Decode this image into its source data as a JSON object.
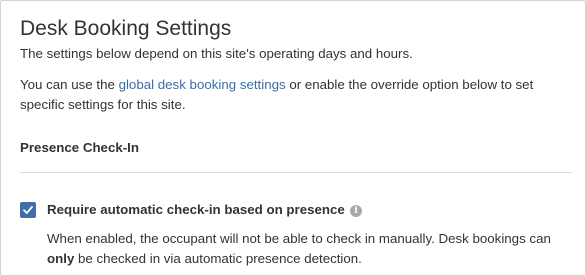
{
  "header": {
    "title": "Desk Booking Settings"
  },
  "intro": {
    "line1": "The settings below depend on this site's operating days and hours.",
    "line2_prefix": "You can use the ",
    "line2_link": "global desk booking settings",
    "line2_suffix": " or enable the override option below to set specific settings for this site."
  },
  "presence_section": {
    "heading": "Presence Check-In",
    "checkbox": {
      "label": "Require automatic check-in based on presence",
      "checked": true,
      "info_icon": "info-icon"
    },
    "description_part1": "When enabled, the occupant will not be able to check in manually. Desk bookings can ",
    "description_bold": "only",
    "description_part2": " be checked in via automatic presence detection."
  },
  "colors": {
    "accent": "#3e6fa8",
    "link": "#3a6ea8"
  }
}
